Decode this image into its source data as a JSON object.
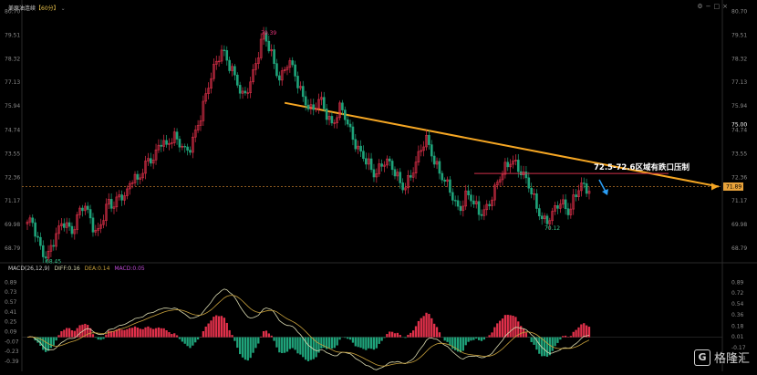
{
  "header": {
    "instrument": "美原油连续",
    "period": "【60分】",
    "macd_params": "MACD(26,12,9)",
    "diff_label": "DIFF:0.16",
    "dea_label": "DEA:0.14",
    "macd_label": "MACD:0.05"
  },
  "colors": {
    "up": "#e0304a",
    "down": "#1fa37a",
    "trend": "#f5a623",
    "resistance": "#d0304a",
    "diff_line": "#d9d9b0",
    "dea_line": "#c8a13c",
    "arrow": "#2a9df4",
    "axis_text": "#8a8a8a",
    "marker_text": "#e8347c"
  },
  "icons": [
    "settings-icon",
    "minimize-icon",
    "maximize-icon",
    "close-icon"
  ],
  "annotation": "72.5-72.6区域有跌口压制",
  "watermark": {
    "badge": "G",
    "text": "格隆汇"
  },
  "chart_data": [
    {
      "type": "candlestick",
      "y_ticks": [
        "80.70",
        "79.51",
        "78.32",
        "77.13",
        "75.94",
        "74.74",
        "73.55",
        "72.36",
        "71.17",
        "69.98",
        "68.79"
      ],
      "ylim": [
        68.2,
        80.9
      ],
      "current_price_label": "71.89",
      "current_price": 71.89,
      "right_extra_tick": "75.00",
      "right_extra_value": 75.0,
      "markers": [
        {
          "label": "68.45",
          "value": 68.45
        },
        {
          "label": "79.39",
          "value": 79.39
        },
        {
          "label": "70.12",
          "value": 70.12
        }
      ],
      "trend_line": {
        "start_price": 76.1,
        "end_price": 71.89
      },
      "resistance_price": 72.55,
      "path": [
        69.9,
        70.1,
        69.6,
        69.0,
        68.6,
        68.45,
        68.8,
        69.3,
        69.8,
        70.2,
        70.0,
        69.7,
        70.1,
        70.6,
        70.9,
        70.5,
        70.1,
        69.6,
        70.0,
        70.5,
        71.0,
        70.8,
        71.3,
        71.7,
        71.4,
        71.9,
        72.3,
        72.0,
        72.6,
        73.1,
        73.5,
        73.2,
        73.7,
        74.1,
        73.8,
        74.3,
        74.6,
        74.2,
        73.9,
        73.4,
        73.8,
        74.5,
        75.2,
        75.9,
        76.6,
        77.2,
        77.8,
        78.4,
        78.9,
        78.4,
        77.9,
        77.3,
        76.7,
        76.3,
        76.8,
        77.4,
        78.1,
        78.8,
        79.39,
        79.0,
        78.5,
        77.9,
        77.4,
        77.7,
        78.1,
        77.8,
        77.3,
        76.8,
        76.4,
        76.0,
        75.6,
        75.9,
        76.2,
        75.8,
        75.4,
        75.1,
        75.5,
        75.8,
        75.3,
        74.8,
        74.4,
        74.0,
        73.6,
        73.2,
        72.8,
        72.4,
        72.7,
        73.1,
        73.4,
        73.0,
        72.6,
        72.2,
        71.8,
        72.1,
        72.5,
        72.9,
        73.3,
        73.8,
        74.2,
        73.8,
        73.3,
        72.8,
        72.3,
        71.9,
        71.5,
        71.1,
        70.8,
        71.2,
        71.6,
        71.2,
        70.8,
        70.5,
        70.7,
        71.0,
        71.4,
        71.8,
        72.2,
        72.6,
        73.0,
        73.4,
        73.1,
        72.7,
        72.3,
        71.9,
        71.5,
        71.0,
        70.6,
        70.2,
        70.12,
        70.4,
        70.8,
        71.2,
        71.0,
        70.7,
        71.1,
        71.5,
        71.9,
        71.7,
        71.89
      ]
    },
    {
      "type": "macd",
      "y_ticks": [
        "0.89",
        "0.73",
        "0.57",
        "0.41",
        "0.25",
        "0.09",
        "-0.07",
        "-0.23",
        "-0.39"
      ],
      "right_ticks": [
        "0.89",
        "0.72",
        "0.54",
        "0.36",
        "0.18",
        "0.01",
        "-0.17",
        "-0.34"
      ],
      "ylim": [
        -0.48,
        0.97
      ],
      "diff": 0.16,
      "dea": 0.14,
      "macd": 0.05
    }
  ]
}
